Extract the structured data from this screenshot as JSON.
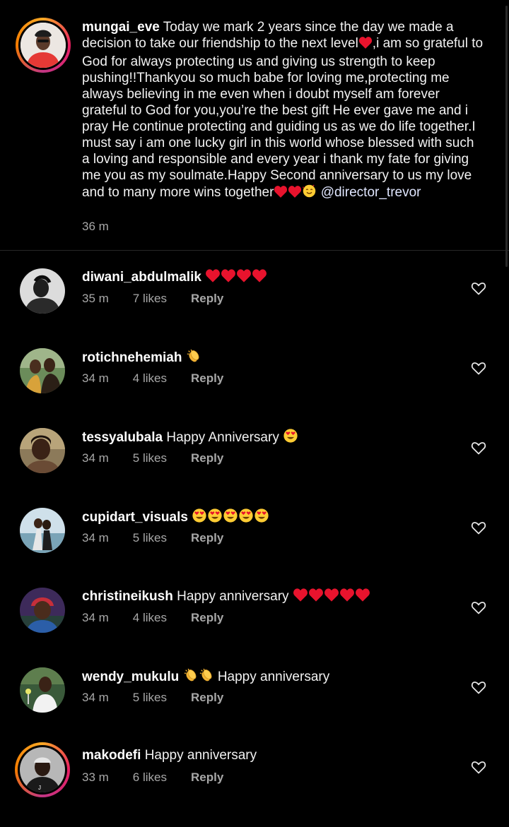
{
  "caption": {
    "username": "mungai_eve",
    "text": "Today we mark 2 years since the day we made a decision to take our friendship to the next level",
    "text_2": ",i am so grateful to God for always protecting us and giving us strength to keep pushing!!Thankyou so much babe for loving me,protecting me always believing in me even when i doubt myself am forever grateful to God for you,you’re the best gift He ever gave me and i pray He continue protecting and guiding us as we do life together.I must say i am one lucky girl in this world whose blessed with such a loving and responsible and every year i thank my fate for giving me you as my soulmate.Happy Second anniversary to us my love and to many more wins together",
    "mention": "@director_trevor",
    "time": "36 m"
  },
  "comments": [
    {
      "username": "diwani_abdulmalik",
      "text": "",
      "emojis": [
        "heart",
        "heart",
        "heart",
        "heart"
      ],
      "emoji_after": true,
      "time": "35 m",
      "likes": "7 likes",
      "reply": "Reply"
    },
    {
      "username": "rotichnehemiah",
      "text": "",
      "emojis": [
        "clap"
      ],
      "emoji_after": true,
      "time": "34 m",
      "likes": "4 likes",
      "reply": "Reply"
    },
    {
      "username": "tessyalubala",
      "text": "Happy Anniversary",
      "emojis": [
        "hearteyes"
      ],
      "emoji_after": true,
      "time": "34 m",
      "likes": "5 likes",
      "reply": "Reply"
    },
    {
      "username": "cupidart_visuals",
      "text": "",
      "emojis": [
        "hearteyes",
        "hearteyes",
        "hearteyes",
        "hearteyes",
        "hearteyes"
      ],
      "emoji_after": true,
      "time": "34 m",
      "likes": "5 likes",
      "reply": "Reply"
    },
    {
      "username": "christineikush",
      "text": "Happy anniversary",
      "emojis": [
        "heart",
        "heart",
        "heart",
        "heart",
        "heart"
      ],
      "emoji_after": true,
      "time": "34 m",
      "likes": "4 likes",
      "reply": "Reply"
    },
    {
      "username": "wendy_mukulu",
      "text": "Happy anniversary",
      "emojis": [
        "clap",
        "clap"
      ],
      "emoji_after": false,
      "time": "34 m",
      "likes": "5 likes",
      "reply": "Reply"
    },
    {
      "username": "makodefi",
      "text": "Happy anniversary",
      "emojis": [],
      "emoji_after": true,
      "time": "33 m",
      "likes": "6 likes",
      "reply": "Reply"
    }
  ],
  "icons": {
    "like": "heart-outline-icon",
    "heart_emoji": "red-heart-emoji",
    "clap_emoji": "clapping-hands-emoji",
    "hearteyes_emoji": "smiling-face-with-heart-eyes-emoji",
    "hug_emoji": "smiling-face-with-hearts-emoji"
  },
  "colors": {
    "background": "#000000",
    "text": "#f2f2f2",
    "secondary": "#a8a8a8",
    "heart": "#e8132d",
    "emoji_yellow": "#ffcc33"
  }
}
